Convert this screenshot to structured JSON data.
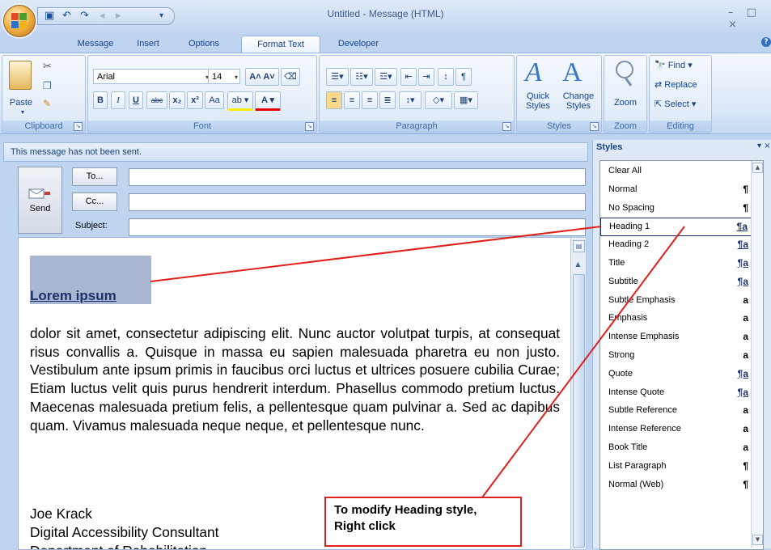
{
  "window": {
    "title": "Untitled - Message (HTML)",
    "controls": "– □ ×"
  },
  "tabs": [
    {
      "label": "Message"
    },
    {
      "label": "Insert"
    },
    {
      "label": "Options"
    },
    {
      "label": "Format Text",
      "active": true
    },
    {
      "label": "Developer"
    }
  ],
  "ribbon": {
    "clipboard": {
      "label": "Clipboard",
      "paste": "Paste"
    },
    "font": {
      "label": "Font",
      "family": "Arial",
      "size": "14",
      "bold": "B",
      "italic": "I",
      "underline": "U",
      "strike": "abc",
      "subscript": "x₂",
      "superscript": "x²",
      "change_case": "Aa",
      "highlight": "ab",
      "color": "A"
    },
    "paragraph": {
      "label": "Paragraph"
    },
    "styles": {
      "label": "Styles",
      "quick_styles": "Quick\nStyles",
      "change_styles": "Change\nStyles"
    },
    "zoom": {
      "label": "Zoom",
      "zoom": "Zoom"
    },
    "editing": {
      "label": "Editing",
      "find": "Find",
      "replace": "Replace",
      "select": "Select"
    }
  },
  "message": {
    "info": "This message has not been sent.",
    "send": "Send",
    "to": "To...",
    "cc": "Cc...",
    "subject_label": "Subject:",
    "heading": "Lorem ipsum",
    "body": "dolor sit amet, consectetur adipiscing elit. Nunc auctor volutpat turpis, at consequat risus convallis a. Quisque in massa eu sapien malesuada pharetra eu non justo. Vestibulum ante ipsum primis in faucibus orci luctus et ultrices posuere cubilia Curae; Etiam luctus velit quis purus hendrerit interdum. Phasellus commodo pretium luctus. Maecenas malesuada pretium felis, a pellentesque quam pulvinar a. Sed ac dapibus quam. Vivamus malesuada neque neque, et pellentesque nunc.",
    "signature": [
      "Joe Krack",
      "Digital Accessibility Consultant",
      "Department of Rehabilitation"
    ]
  },
  "styles_pane": {
    "title": "Styles",
    "items": [
      {
        "name": "Clear All",
        "icon": ""
      },
      {
        "name": "Normal",
        "icon": "¶"
      },
      {
        "name": "No Spacing",
        "icon": "¶"
      },
      {
        "name": "Heading 1",
        "icon": "¶a",
        "selected": true
      },
      {
        "name": "Heading 2",
        "icon": "¶a"
      },
      {
        "name": "Title",
        "icon": "¶a"
      },
      {
        "name": "Subtitle",
        "icon": "¶a"
      },
      {
        "name": "Subtle Emphasis",
        "icon": "a"
      },
      {
        "name": "Emphasis",
        "icon": "a"
      },
      {
        "name": "Intense Emphasis",
        "icon": "a"
      },
      {
        "name": "Strong",
        "icon": "a"
      },
      {
        "name": "Quote",
        "icon": "¶a"
      },
      {
        "name": "Intense Quote",
        "icon": "¶a"
      },
      {
        "name": "Subtle Reference",
        "icon": "a"
      },
      {
        "name": "Intense Reference",
        "icon": "a"
      },
      {
        "name": "Book Title",
        "icon": "a"
      },
      {
        "name": "List Paragraph",
        "icon": "¶"
      },
      {
        "name": "Normal (Web)",
        "icon": "¶"
      }
    ]
  },
  "callout": {
    "line1": "To modify Heading style,",
    "line2": "Right click"
  },
  "colors": {
    "annotation": "#e0201c",
    "selection": "#a9b6d1"
  }
}
